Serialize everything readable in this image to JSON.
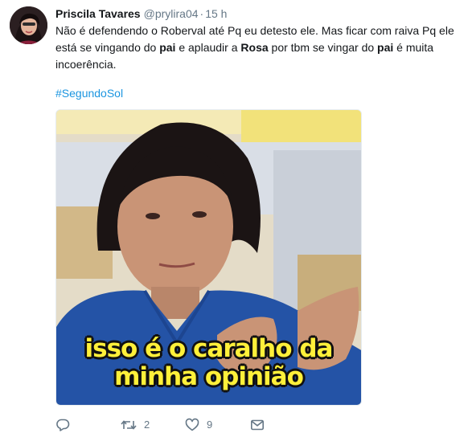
{
  "tweet": {
    "author_name": "Priscila Tavares",
    "handle": "@prylira04",
    "separator": "·",
    "time": "15 h",
    "text": {
      "p1": "Não é defendendo o Roberval até Pq eu detesto ele. Mas ficar com raiva Pq ele está se vingando do ",
      "b1": "pai",
      "p2": " e aplaudir a ",
      "b2": "Rosa",
      "p3": " por tbm se vingar do ",
      "b3": "pai",
      "p4": " é muita incoerência."
    },
    "hashtag": "#SegundoSol",
    "media": {
      "caption_line1": "isso é o caralho da",
      "caption_line2": "minha opinião"
    },
    "actions": {
      "reply_icon": "reply-icon",
      "retweet_icon": "retweet-icon",
      "retweet_count": "2",
      "like_icon": "heart-icon",
      "like_count": "9",
      "dm_icon": "envelope-icon"
    }
  },
  "colors": {
    "link": "#1b95e0",
    "muted": "#657786",
    "text": "#14171a",
    "caption": "#fff03a"
  }
}
